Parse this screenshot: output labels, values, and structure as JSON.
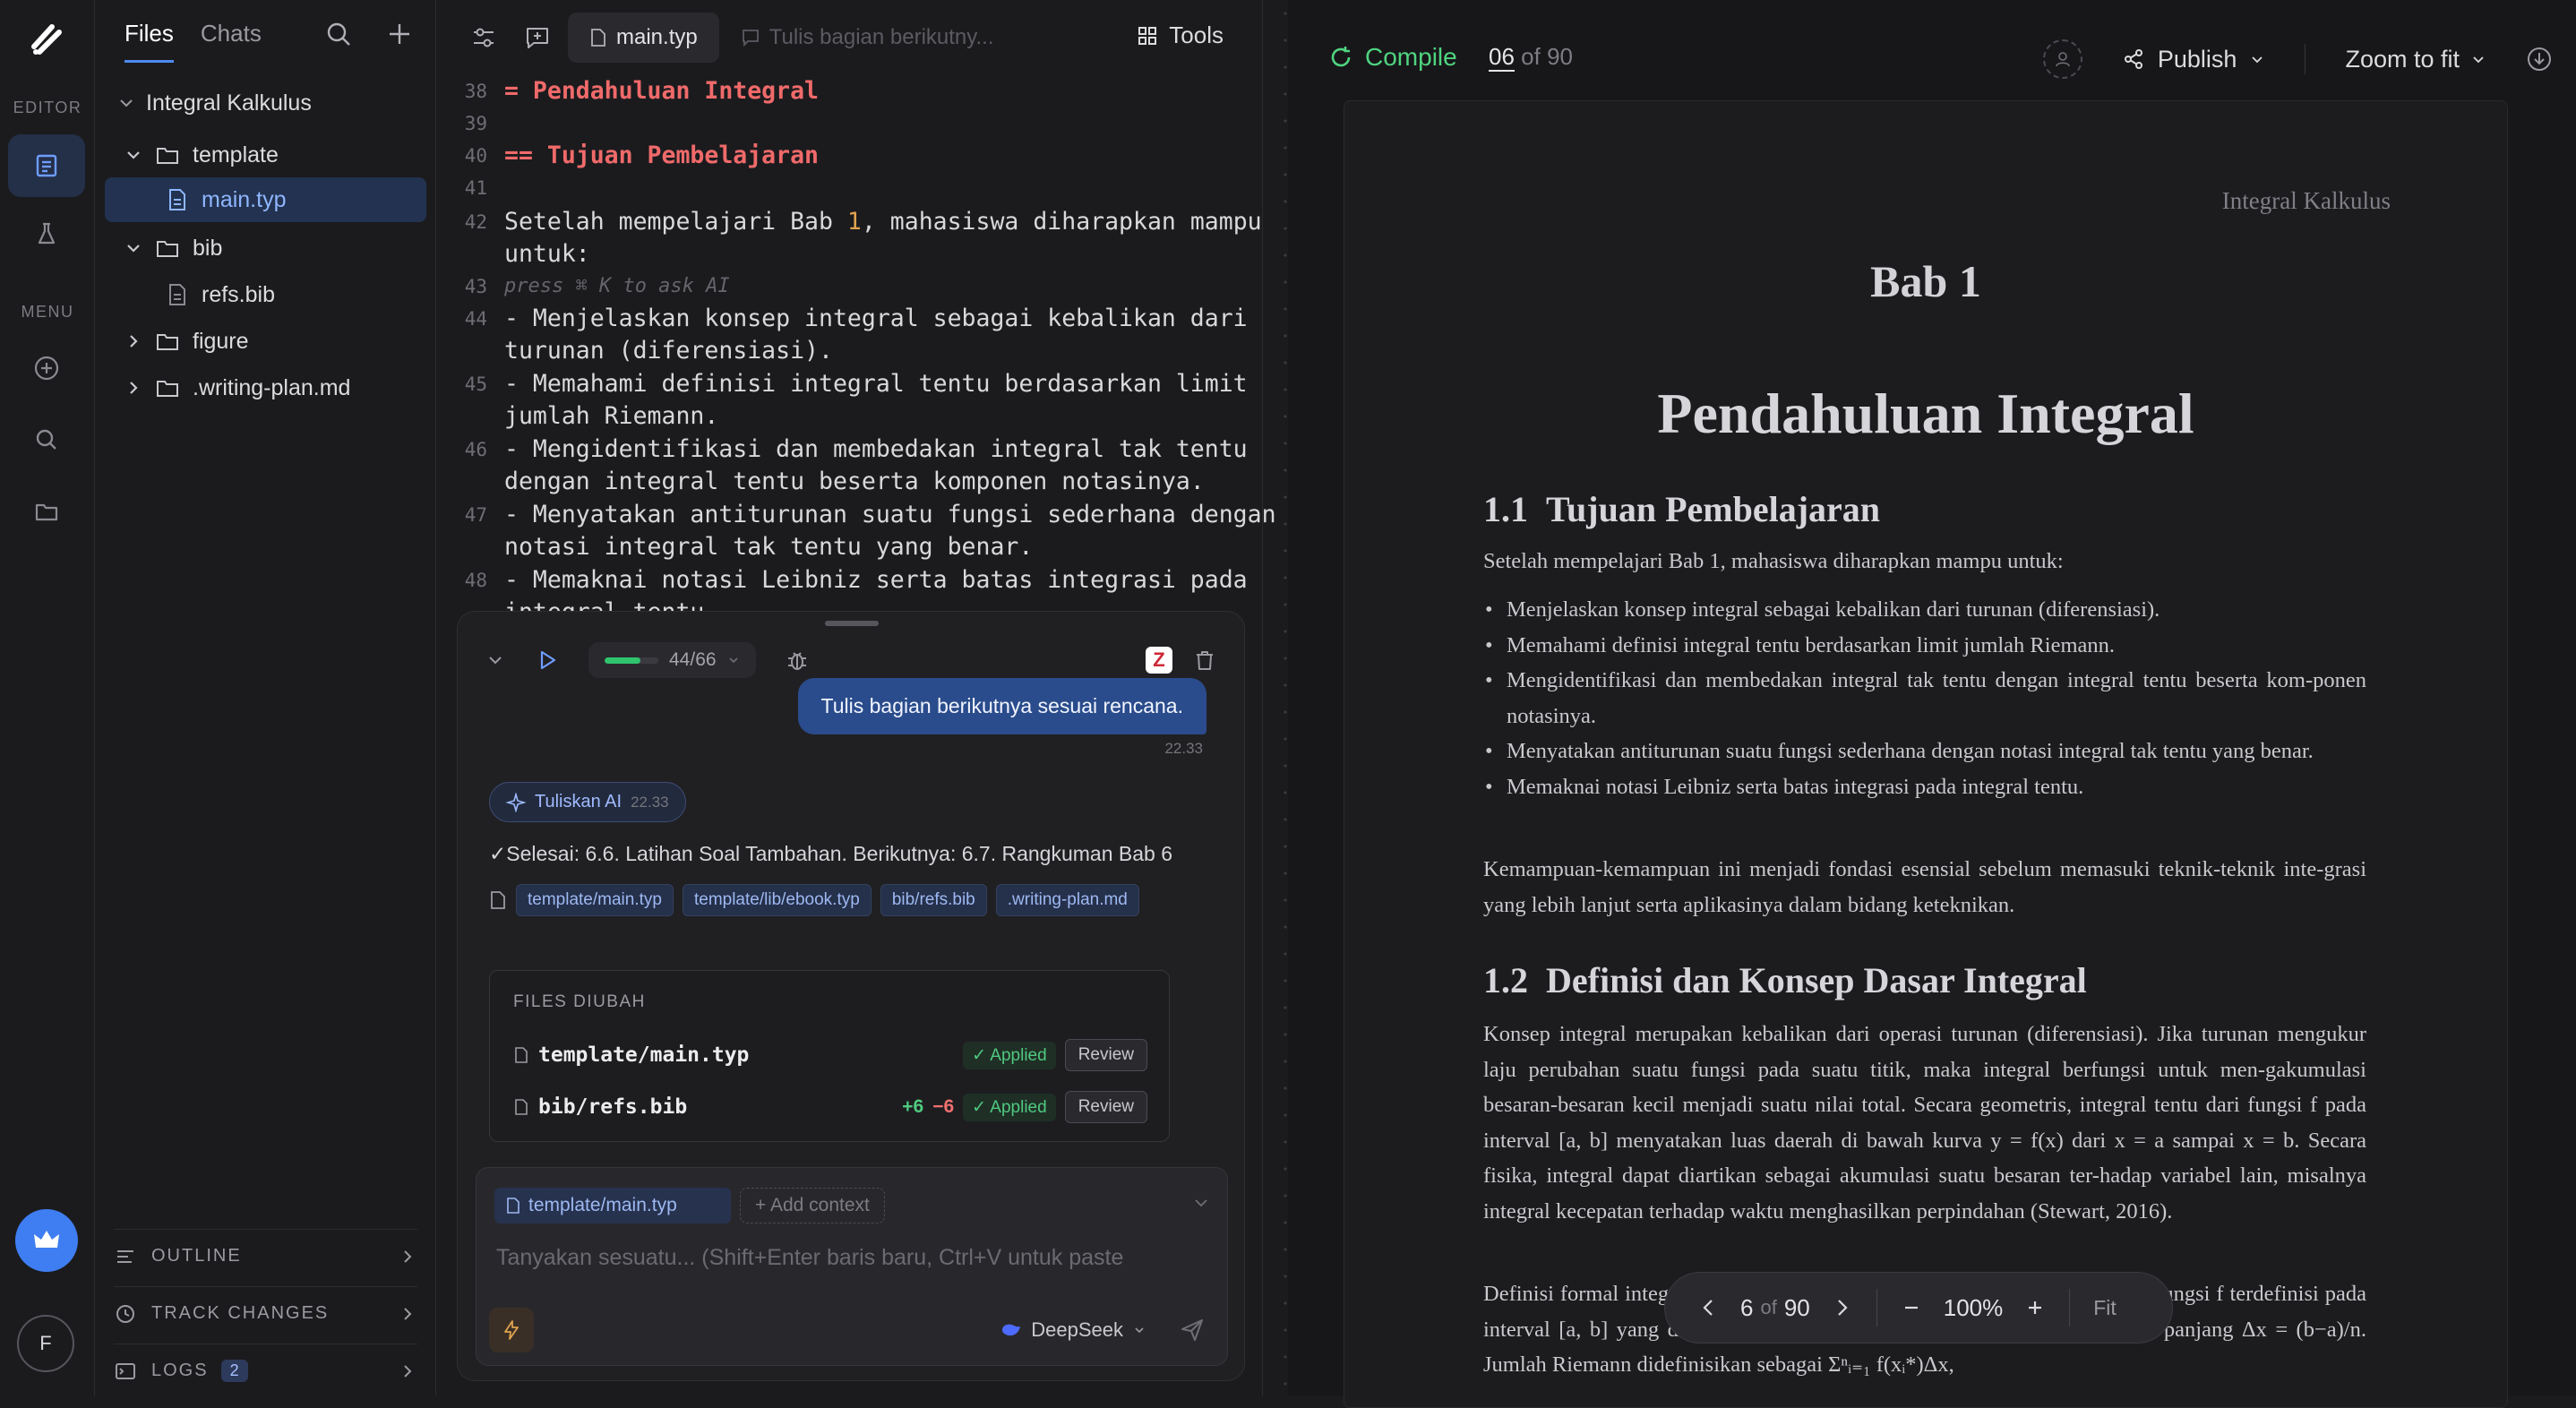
{
  "rail": {
    "section_editor": "EDITOR",
    "section_menu": "MENU",
    "avatar_initial": "F"
  },
  "file_panel": {
    "tabs": [
      "Files",
      "Chats"
    ],
    "project": "Integral Kalkulus",
    "tree": [
      {
        "label": "template",
        "type": "folder",
        "open": true
      },
      {
        "label": "main.typ",
        "type": "file",
        "selected": true
      },
      {
        "label": "bib",
        "type": "folder",
        "open": true
      },
      {
        "label": "refs.bib",
        "type": "file"
      },
      {
        "label": "figure",
        "type": "folder",
        "open": false
      },
      {
        "label": ".writing-plan.md",
        "type": "folder",
        "open": false
      }
    ],
    "bottom": {
      "outline": "OUTLINE",
      "track_changes": "TRACK CHANGES",
      "logs": "LOGS",
      "logs_count": "2"
    }
  },
  "editor": {
    "active_tab": "main.typ",
    "ghost_tab": "Tulis bagian berikutny...",
    "tools_label": "Tools",
    "lines": [
      {
        "n": "38",
        "text": "= Pendahuluan Integral"
      },
      {
        "n": "39",
        "text": ""
      },
      {
        "n": "40",
        "text": "== Tujuan Pembelajaran"
      },
      {
        "n": "41",
        "text": ""
      },
      {
        "n": "42",
        "pre": "Setelah mempelajari Bab ",
        "num": "1",
        "post": ", mahasiswa diharapkan mampu",
        "cont": "untuk:"
      },
      {
        "n": "43",
        "ghost": "press ⌘ K to ask AI"
      },
      {
        "n": "44",
        "text": "- Menjelaskan konsep integral sebagai kebalikan dari",
        "cont": "turunan (diferensiasi)."
      },
      {
        "n": "45",
        "text": "- Memahami definisi integral tentu berdasarkan limit",
        "cont": "jumlah Riemann."
      },
      {
        "n": "46",
        "text": "- Mengidentifikasi dan membedakan integral tak tentu",
        "cont": "dengan integral tentu beserta komponen notasinya."
      },
      {
        "n": "47",
        "text": "- Menyatakan antiturunan suatu fungsi sederhana dengan",
        "cont": "notasi integral tak tentu yang benar."
      },
      {
        "n": "48",
        "text": "- Memaknai notasi Leibniz serta batas integrasi pada",
        "cont": "integral tentu."
      }
    ]
  },
  "chat": {
    "progress_text": "44/66",
    "progress_fraction": 0.67,
    "user_message": "Tulis bagian berikutnya sesuai rencana.",
    "user_time": "22.33",
    "ai_name": "Tuliskan AI",
    "ai_time": "22.33",
    "status": "✓Selesai: 6.6. Latihan Soal Tambahan. Berikutnya: 6.7. Rangkuman Bab 6",
    "file_tags": [
      "template/main.typ",
      "template/lib/ebook.typ",
      "bib/refs.bib",
      ".writing-plan.md"
    ],
    "files_changed_title": "FILES DIUBAH",
    "files_changed": [
      {
        "name": "template/main.typ",
        "plus": "",
        "minus": "",
        "status": "Applied",
        "action": "Review"
      },
      {
        "name": "bib/refs.bib",
        "plus": "+6",
        "minus": "−6",
        "status": "Applied",
        "action": "Review"
      }
    ],
    "context_chip": "template/main.typ",
    "add_context": "+ Add context",
    "placeholder": "Tanyakan sesuatu... (Shift+Enter baris baru, Ctrl+V untuk paste",
    "model": "DeepSeek"
  },
  "preview": {
    "compile_label": "Compile",
    "page_current": "06",
    "page_of": "of 90",
    "publish_label": "Publish",
    "zoom_label": "Zoom to fit",
    "page": {
      "running_header": "Integral Kalkulus",
      "chapter": "Bab 1",
      "title": "Pendahuluan Integral",
      "s1_num": "1.1",
      "s1_title": "Tujuan Pembelajaran",
      "s1_intro": "Setelah mempelajari Bab 1, mahasiswa diharapkan mampu untuk:",
      "s1_items": [
        "Menjelaskan konsep integral sebagai kebalikan dari turunan (diferensiasi).",
        "Memahami definisi integral tentu berdasarkan limit jumlah Riemann.",
        "Mengidentifikasi dan membedakan integral tak tentu dengan integral tentu beserta kom-ponen notasinya.",
        "Menyatakan antiturunan suatu fungsi sederhana dengan notasi integral tak tentu yang benar.",
        "Memaknai notasi Leibniz serta batas integrasi pada integral tentu."
      ],
      "s1_outro": "Kemampuan-kemampuan ini menjadi fondasi esensial sebelum memasuki teknik-teknik inte-grasi yang lebih lanjut serta aplikasinya dalam bidang keteknikan.",
      "s2_num": "1.2",
      "s2_title": "Definisi dan Konsep Dasar Integral",
      "s2_p1": "Konsep integral merupakan kebalikan dari operasi turunan (diferensiasi). Jika turunan mengukur laju perubahan suatu fungsi pada suatu titik, maka integral berfungsi untuk men-gakumulasi besaran-besaran kecil menjadi suatu nilai total. Secara geometris, integral tentu dari fungsi f pada interval [a, b] menyatakan luas daerah di bawah kurva y = f(x) dari x = a sampai x = b. Secara fisika, integral dapat diartikan sebagai akumulasi suatu besaran ter-hadap variabel lain, misalnya integral kecepatan terhadap waktu menghasilkan perpindahan (Stewart, 2016).",
      "s2_p2": "Definisi formal integral tentu diperoleh melalui jumlah Riemann. Misalkan fungsi f terdefinisi pada interval [a, b] yang dibagi menjadi n subinterval yang sama lebar dengan panjang Δx = (b−a)/n. Jumlah Riemann didefinisikan sebagai Σⁿᵢ₌₁ f(xᵢ*)Δx,"
    },
    "pager": {
      "page": "6",
      "of": "of",
      "total": "90",
      "zoom": "100%",
      "fit": "Fit"
    }
  },
  "colors": {
    "accent": "#3f7ef2",
    "compile_green": "#4fd47f",
    "heading_red": "#f06a6a",
    "number_orange": "#e0a24e"
  }
}
